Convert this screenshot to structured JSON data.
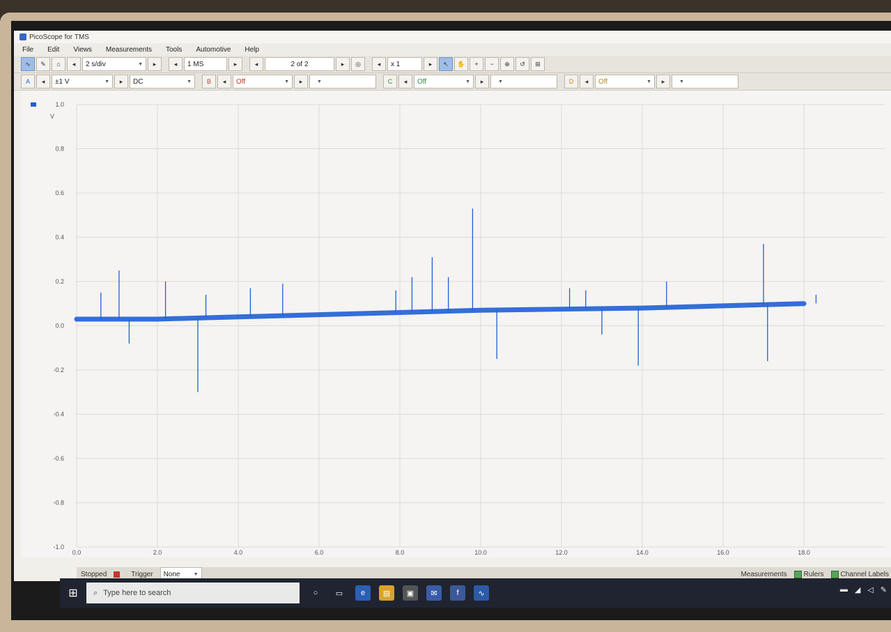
{
  "app": {
    "title": "PicoScope for TMS"
  },
  "menu": [
    "File",
    "Edit",
    "Views",
    "Measurements",
    "Tools",
    "Automotive",
    "Help"
  ],
  "toolbar1": {
    "timebase": "2 s/div",
    "samples": "1 MS",
    "buffer": "2 of 2",
    "zoom": "x 1"
  },
  "toolbar2": {
    "channel_a_range": "±1 V",
    "channel_a_coupling": "DC",
    "channel_b_range": "Off",
    "channel_c_range": "Off",
    "channel_d_range": "Off"
  },
  "chart_data": {
    "type": "line",
    "ylabel": "V",
    "ylim": [
      -1.0,
      1.0
    ],
    "xlim": [
      0.0,
      18.0
    ],
    "y_ticks": [
      "1.0",
      "0.8",
      "0.6",
      "0.4",
      "0.2",
      "0.0",
      "-0.2",
      "-0.4",
      "-0.6",
      "-0.8",
      "-1.0"
    ],
    "x_ticks": [
      "0.0",
      "2.0",
      "4.0",
      "6.0",
      "8.0",
      "10.0",
      "12.0",
      "14.0",
      "16.0",
      "18.0"
    ],
    "series": [
      {
        "x": [
          0.0,
          2.0,
          4.0,
          6.0,
          8.0,
          10.0,
          12.0,
          14.0,
          16.0,
          18.0
        ],
        "values": [
          0.03,
          0.03,
          0.04,
          0.05,
          0.06,
          0.07,
          0.075,
          0.08,
          0.09,
          0.1
        ]
      }
    ],
    "spikes": [
      {
        "x": 0.6,
        "y": 0.15
      },
      {
        "x": 1.05,
        "y": 0.25
      },
      {
        "x": 1.3,
        "y": -0.08
      },
      {
        "x": 2.2,
        "y": 0.2
      },
      {
        "x": 3.0,
        "y": -0.3
      },
      {
        "x": 3.2,
        "y": 0.14
      },
      {
        "x": 4.3,
        "y": 0.17
      },
      {
        "x": 5.1,
        "y": 0.19
      },
      {
        "x": 7.9,
        "y": 0.16
      },
      {
        "x": 8.3,
        "y": 0.22
      },
      {
        "x": 8.8,
        "y": 0.31
      },
      {
        "x": 9.2,
        "y": 0.22
      },
      {
        "x": 9.8,
        "y": 0.53
      },
      {
        "x": 10.4,
        "y": -0.15
      },
      {
        "x": 12.2,
        "y": 0.17
      },
      {
        "x": 12.6,
        "y": 0.16
      },
      {
        "x": 13.0,
        "y": -0.04
      },
      {
        "x": 13.9,
        "y": -0.18
      },
      {
        "x": 14.6,
        "y": 0.2
      },
      {
        "x": 17.0,
        "y": 0.37
      },
      {
        "x": 17.1,
        "y": -0.16
      },
      {
        "x": 18.3,
        "y": 0.14
      }
    ],
    "color": "#1f5fd6",
    "grid": true
  },
  "status": {
    "state": "Stopped",
    "trigger_label": "Trigger",
    "trigger_value": "None",
    "measurements": "Measurements",
    "rulers": "Rulers",
    "channel_labels": "Channel Labels"
  },
  "taskbar": {
    "search_placeholder": "Type here to search"
  }
}
